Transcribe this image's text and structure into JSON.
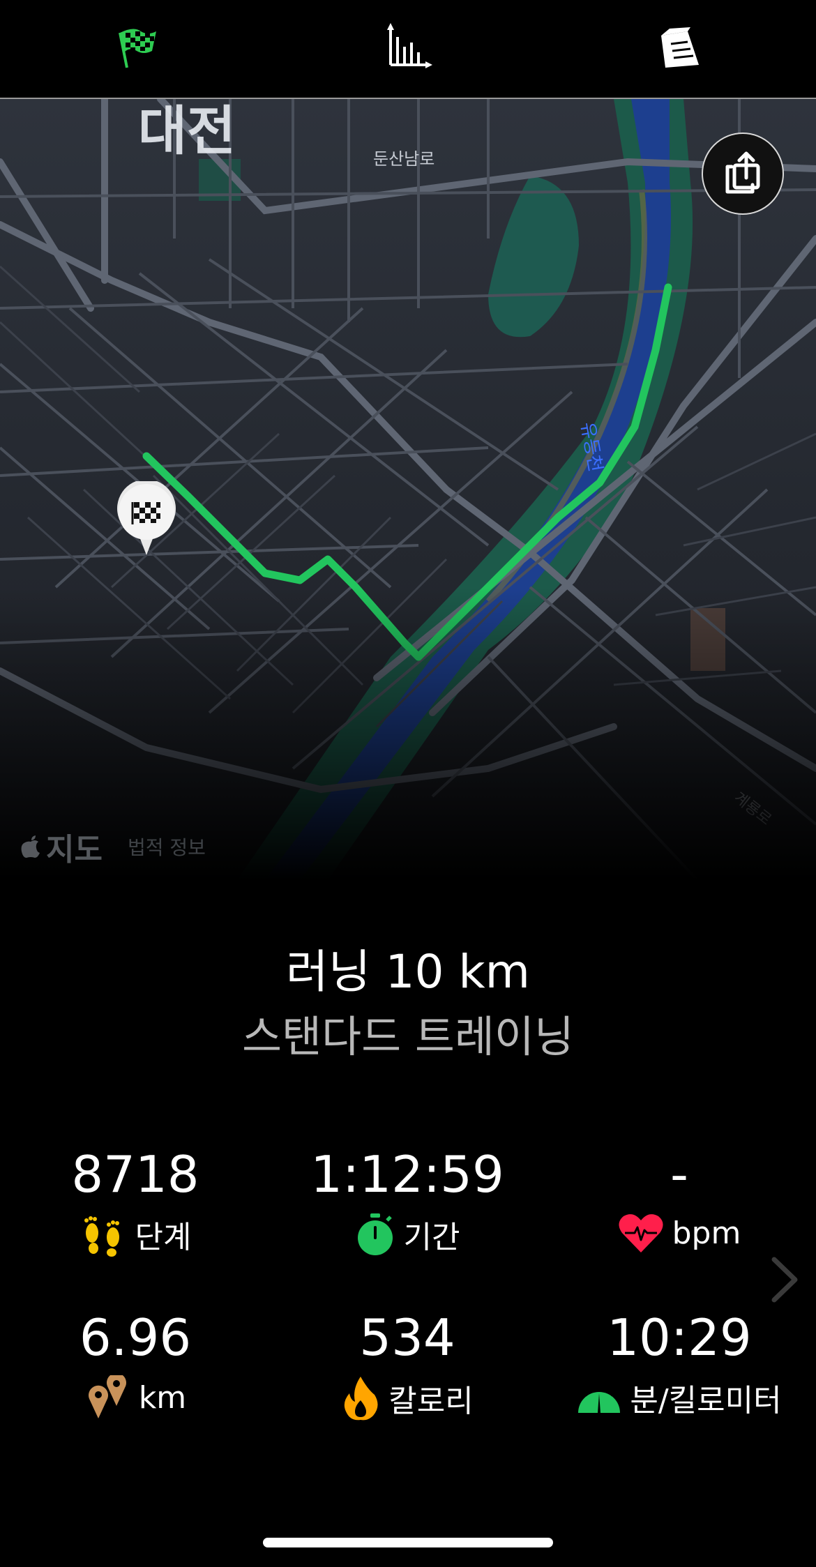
{
  "tabs": [
    {
      "icon": "checkered-flag-icon",
      "color": "#2ecc52"
    },
    {
      "icon": "bar-chart-icon",
      "color": "#ffffff"
    },
    {
      "icon": "shopping-bag-icon",
      "color": "#ffffff"
    }
  ],
  "map": {
    "city_label": "대전",
    "road_label": "둔산남로",
    "river_label": "유등천",
    "road_label_2": "계룡로",
    "brand": "지도",
    "legal": "법적 정보",
    "route_color": "#22c55e"
  },
  "workout": {
    "title": "러닝 10 km",
    "subtitle": "스탠다드 트레이닝"
  },
  "stats": {
    "steps": {
      "value": "8718",
      "label": "단계",
      "icon": "footprints-icon"
    },
    "duration": {
      "value": "1:12:59",
      "label": "기간",
      "icon": "stopwatch-icon"
    },
    "heart_rate": {
      "value": "-",
      "label": "bpm",
      "icon": "heart-icon"
    },
    "distance": {
      "value": "6.96",
      "label": "km",
      "icon": "location-pins-icon"
    },
    "calories": {
      "value": "534",
      "label": "칼로리",
      "icon": "flame-icon"
    },
    "pace": {
      "value": "10:29",
      "label": "분/킬로미터",
      "icon": "speedometer-icon"
    }
  },
  "colors": {
    "accent_green": "#22c55e",
    "heart_red": "#ff1f4b",
    "flame_orange": "#ffa500",
    "steps_yellow": "#f5c400",
    "pin_brown": "#c8925a"
  }
}
